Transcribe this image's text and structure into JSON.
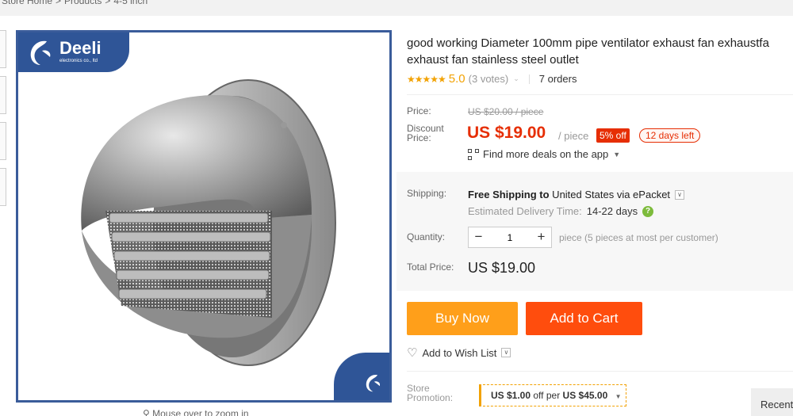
{
  "breadcrumb": {
    "items": [
      "Store Home",
      ">",
      "Products",
      ">",
      "4-5 inch"
    ]
  },
  "gallery": {
    "brand": "Deeli",
    "brand_sub": "electronics co., ltd",
    "zoom_hint": "Mouse over to zoom in"
  },
  "product": {
    "title_line1": "good working Diameter 100mm pipe ventilator exhaust fan exhaustfa",
    "title_line2": "exhaust fan stainless steel outlet",
    "stars": "★★★★★",
    "rating": "5.0",
    "votes": "(3 votes)",
    "orders": "7 orders"
  },
  "pricing": {
    "price_label": "Price:",
    "old_price": "US $20.00 / piece",
    "discount_label_1": "Discount",
    "discount_label_2": "Price:",
    "price": "US $19.00",
    "per": "/ piece",
    "off": "5% off",
    "days_left": "12 days left",
    "deals": "Find more deals on the app"
  },
  "shipping": {
    "label": "Shipping:",
    "free": "Free Shipping to",
    "dest": " United States via ePacket",
    "delivery_label": "Estimated Delivery Time:",
    "delivery_value": "14-22 days"
  },
  "quantity": {
    "label": "Quantity:",
    "minus": "−",
    "value": "1",
    "plus": "+",
    "note": "piece (5 pieces at most per customer)"
  },
  "total": {
    "label": "Total Price:",
    "value": "US $19.00"
  },
  "actions": {
    "buy_now": "Buy Now",
    "add_to_cart": "Add to Cart",
    "wish": "Add to Wish List"
  },
  "promotion": {
    "label_1": "Store",
    "label_2": "Promotion:",
    "amount": "US $1.00",
    "mid": " off per ",
    "threshold": "US $45.00"
  },
  "recent": "Recent",
  "colors": {
    "accent_orange": "#ff9f1a",
    "cart_red": "#ff4d0d",
    "price_red": "#e62e04",
    "brand_blue": "#2f5597",
    "star": "#f2a203"
  }
}
